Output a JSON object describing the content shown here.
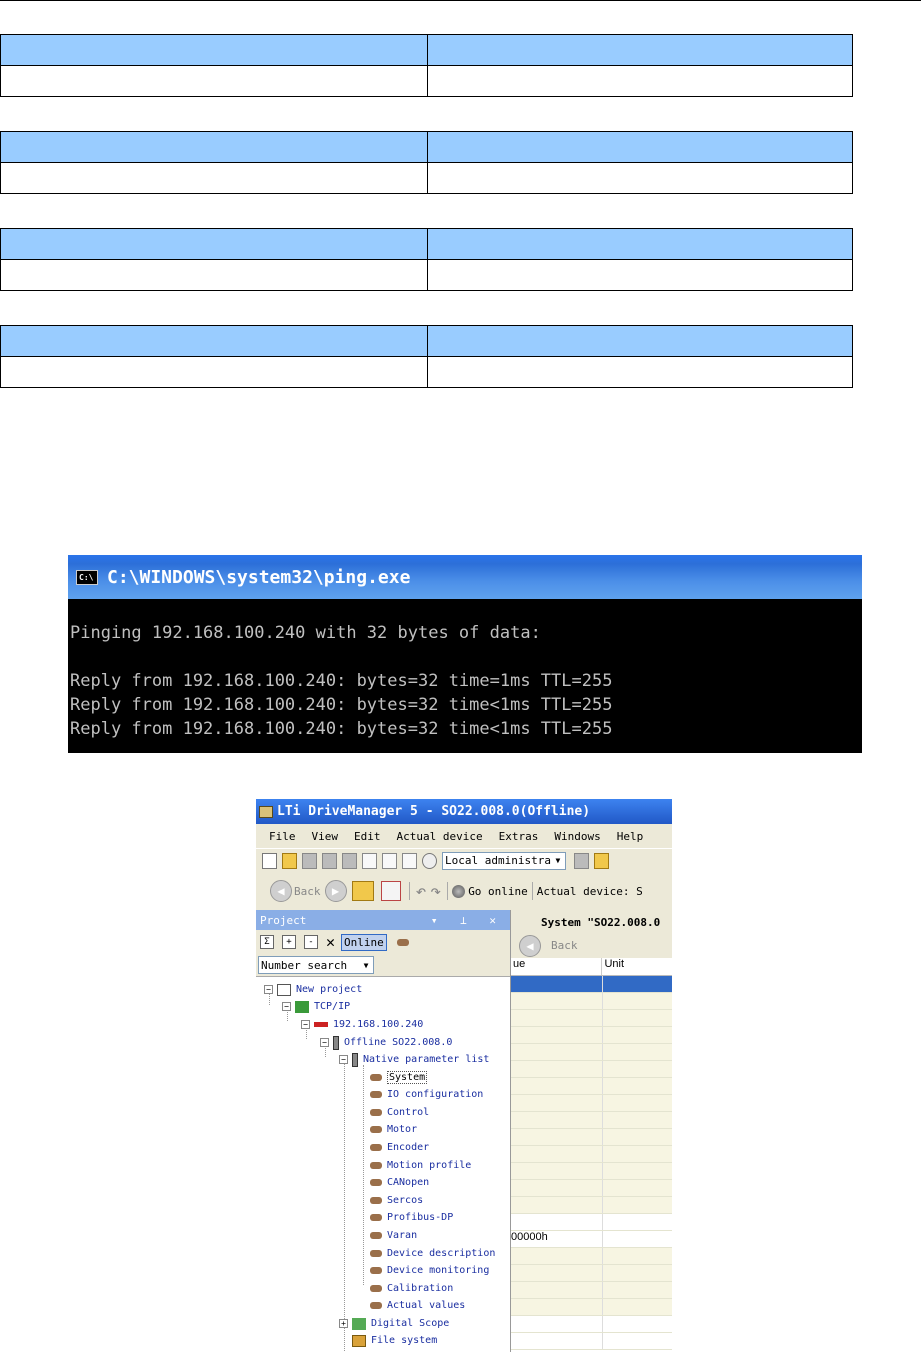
{
  "console": {
    "title": "C:\\WINDOWS\\system32\\ping.exe",
    "icon_label": "C:\\",
    "lines": [
      "Pinging 192.168.100.240 with 32 bytes of data:",
      "",
      "Reply from 192.168.100.240: bytes=32 time=1ms TTL=255",
      "Reply from 192.168.100.240: bytes=32 time<1ms TTL=255",
      "Reply from 192.168.100.240: bytes=32 time<1ms TTL=255"
    ]
  },
  "dm": {
    "title": "LTi DriveManager 5 - SO22.008.0(Offline)",
    "menu": [
      "File",
      "View",
      "Edit",
      "Actual device",
      "Extras",
      "Windows",
      "Help"
    ],
    "user_combo": "Local administra",
    "back_label": "Back",
    "go_online_label": "Go online",
    "actual_device_label": "Actual device: S",
    "project": {
      "header": "Project",
      "online_button": "Online",
      "search_combo": "Number search",
      "tree": {
        "new_project": "New project",
        "tcpip": "TCP/IP",
        "ip": "192.168.100.240",
        "device": "Offline SO22.008.0",
        "param_list": "Native parameter list",
        "items": [
          "System",
          "IO configuration",
          "Control",
          "Motor",
          "Encoder",
          "Motion profile",
          "CANopen",
          "Sercos",
          "Profibus-DP",
          "Varan",
          "Device description",
          "Device monitoring",
          "Calibration",
          "Actual values"
        ],
        "digital_scope": "Digital Scope",
        "file_system": "File system"
      }
    },
    "right": {
      "tab_title": "System \"SO22.008.0",
      "back_label": "Back",
      "col_value": "ue",
      "col_unit": "Unit",
      "value_cell": "00000h"
    }
  }
}
